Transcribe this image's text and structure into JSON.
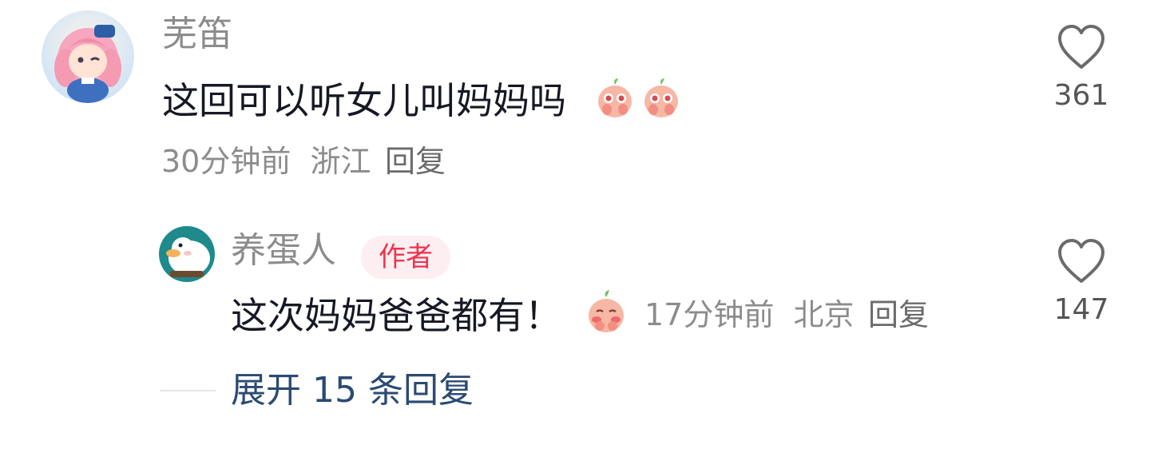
{
  "comments": [
    {
      "username": "芜笛",
      "text": "这回可以听女儿叫妈妈吗",
      "emoji": "peach-shy-emoji",
      "time": "30分钟前",
      "location": "浙江",
      "reply_label": "回复",
      "like_count": "361",
      "avatar": "anime-girl-avatar"
    }
  ],
  "reply": {
    "username": "养蛋人",
    "badge": "作者",
    "text": "这次妈妈爸爸都有！",
    "emoji": "peach-blush-emoji",
    "time": "17分钟前",
    "location": "北京",
    "reply_label": "回复",
    "like_count": "147",
    "avatar": "duck-avatar"
  },
  "expand": {
    "label": "展开 15 条回复"
  },
  "colors": {
    "text_primary": "#161823",
    "text_secondary": "#8c8c8c",
    "badge_bg": "#fdeef1",
    "badge_text": "#f0334d",
    "expand_link": "#2b4a73"
  }
}
